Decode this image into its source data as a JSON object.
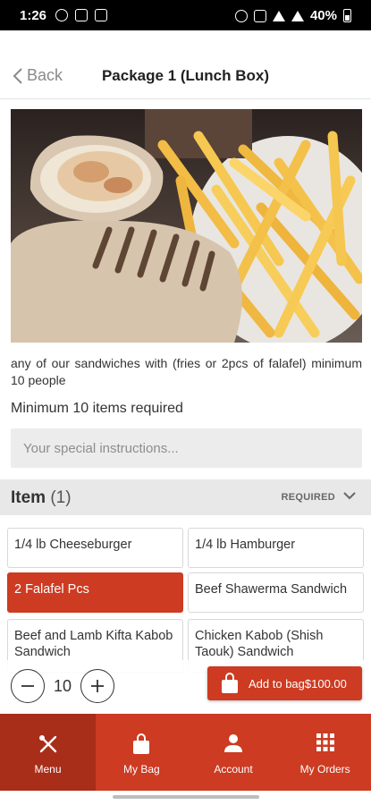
{
  "status_bar": {
    "time": "1:26",
    "battery": "40%"
  },
  "header": {
    "back_label": "Back",
    "title": "Package 1 (Lunch Box)"
  },
  "hero": {
    "alt": "Grilled wrap sandwich with french fries"
  },
  "description": "any of our sandwiches with (fries or 2pcs of falafel) minimum 10 people",
  "min_required": "Minimum 10 items required",
  "instructions": {
    "placeholder": "Your special instructions...",
    "value": ""
  },
  "section": {
    "name": "Item",
    "count": "(1)",
    "required_label": "REQUIRED"
  },
  "options": [
    {
      "label": "1/4 lb Cheeseburger",
      "selected": false
    },
    {
      "label": "1/4 lb Hamburger",
      "selected": false
    },
    {
      "label": "2 Falafel Pcs",
      "selected": true
    },
    {
      "label": "Beef Shawerma Sandwich",
      "selected": false
    },
    {
      "label": "Beef and Lamb Kifta Kabob Sandwich",
      "selected": false
    },
    {
      "label": "Chicken Kabob (Shish Taouk) Sandwich",
      "selected": false
    }
  ],
  "quantity": "10",
  "add_button": {
    "label": "Add to bag$100.00"
  },
  "nav": [
    {
      "label": "Menu",
      "icon": "fork-knife-icon",
      "active": true
    },
    {
      "label": "My Bag",
      "icon": "shopping-bag-icon",
      "active": false
    },
    {
      "label": "Account",
      "icon": "person-icon",
      "active": false
    },
    {
      "label": "My Orders",
      "icon": "grid-icon",
      "active": false
    }
  ],
  "colors": {
    "accent": "#cc3b22",
    "nav_active": "#a82e1a"
  }
}
